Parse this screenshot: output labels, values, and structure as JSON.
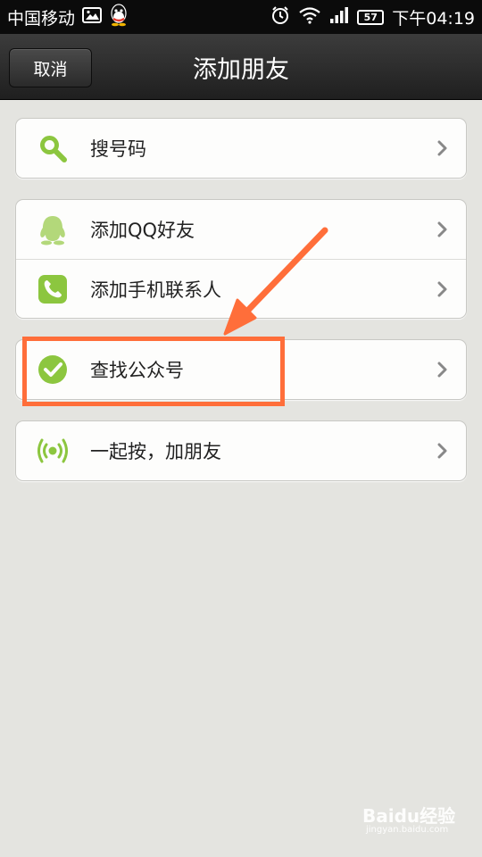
{
  "status_bar": {
    "carrier": "中国移动",
    "battery": "57",
    "time": "下午04:19",
    "icons": [
      "gallery-icon",
      "qq-icon",
      "alarm-icon",
      "wifi-icon",
      "signal-icon",
      "battery-icon"
    ]
  },
  "header": {
    "cancel_label": "取消",
    "title": "添加朋友"
  },
  "menu": {
    "search_number": {
      "label": "搜号码",
      "icon": "search-icon"
    },
    "add_qq_friends": {
      "label": "添加QQ好友",
      "icon": "qq-icon"
    },
    "add_phone_contacts": {
      "label": "添加手机联系人",
      "icon": "phone-icon"
    },
    "find_public_accounts": {
      "label": "查找公众号",
      "icon": "check-icon"
    },
    "shake_together": {
      "label": "一起按，加朋友",
      "icon": "radar-icon"
    }
  },
  "annotation": {
    "highlight_color": "#ff6e3a",
    "target": "find_public_accounts"
  },
  "watermark": {
    "brand": "Baidu经验",
    "sub": "jingyan.baidu.com"
  },
  "colors": {
    "accent_green": "#8cc63f",
    "background": "#e4e4e0",
    "title_bar": "#2a2a2a"
  }
}
